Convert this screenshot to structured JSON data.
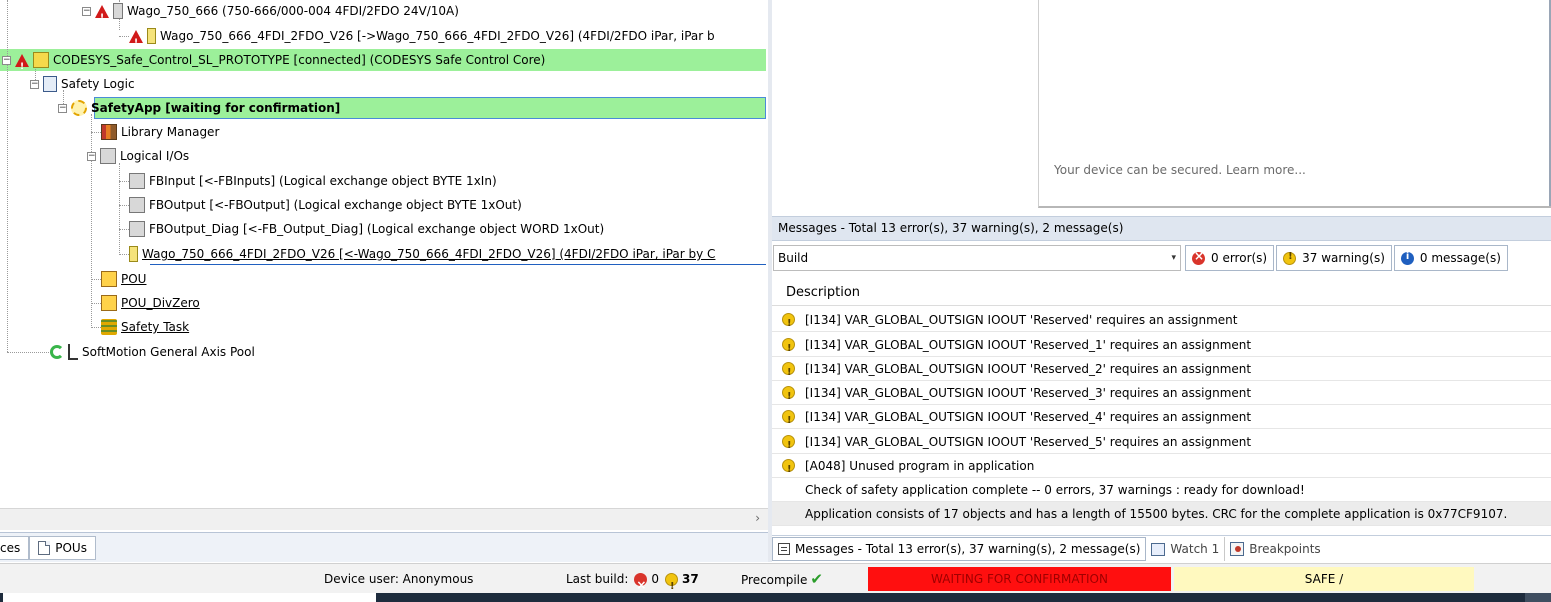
{
  "tree": {
    "rows": [
      {
        "text": "Wago_750_666 (750-666/000-004 4FDI/2FDO 24V/10A)"
      },
      {
        "text": "Wago_750_666_4FDI_2FDO_V26 [->Wago_750_666_4FDI_2FDO_V26]  (4FDI/2FDO iPar, iPar b"
      },
      {
        "text": "CODESYS_Safe_Control_SL_PROTOTYPE [connected] (CODESYS Safe Control Core)"
      },
      {
        "text": "Safety Logic"
      },
      {
        "text": "SafetyApp [waiting for confirmation]"
      },
      {
        "text": "Library Manager"
      },
      {
        "text": "Logical I/Os"
      },
      {
        "text": "FBInput [<-FBInputs]  (Logical exchange object BYTE 1xIn)"
      },
      {
        "text": "FBOutput [<-FBOutput]  (Logical exchange object BYTE 1xOut)"
      },
      {
        "text": "FBOutput_Diag [<-FB_Output_Diag]  (Logical exchange object WORD 1xOut)"
      },
      {
        "text": "Wago_750_666_4FDI_2FDO_V26 [<-Wago_750_666_4FDI_2FDO_V26]  (4FDI/2FDO iPar, iPar by C"
      },
      {
        "text": "POU"
      },
      {
        "text": "POU_DivZero"
      },
      {
        "text": "Safety Task"
      },
      {
        "text": "SoftMotion General Axis Pool"
      }
    ],
    "expander_collapse": "−"
  },
  "left_tabs": {
    "devices_label": "ces",
    "pous_label": "POUs"
  },
  "scroll_arrow": "›",
  "browser": {
    "secured_text": "Your device can be secured. Learn more..."
  },
  "messages": {
    "title": "Messages - Total 13 error(s), 37 warning(s), 2 message(s)",
    "source_select": "Build",
    "dropdown_glyph": "▾",
    "filters": {
      "errors": "0 error(s)",
      "warnings": "37 warning(s)",
      "messages": "0 message(s)"
    },
    "column_description": "Description",
    "rows": [
      {
        "text": "[I134] VAR_GLOBAL_OUTSIGN IOOUT 'Reserved' requires an assignment"
      },
      {
        "text": "[I134] VAR_GLOBAL_OUTSIGN IOOUT 'Reserved_1' requires an assignment"
      },
      {
        "text": "[I134] VAR_GLOBAL_OUTSIGN IOOUT 'Reserved_2' requires an assignment"
      },
      {
        "text": "[I134] VAR_GLOBAL_OUTSIGN IOOUT 'Reserved_3' requires an assignment"
      },
      {
        "text": "[I134] VAR_GLOBAL_OUTSIGN IOOUT 'Reserved_4' requires an assignment"
      },
      {
        "text": "[I134] VAR_GLOBAL_OUTSIGN IOOUT 'Reserved_5' requires an assignment"
      },
      {
        "text": "[A048] Unused program in application"
      },
      {
        "text": "Check of safety application complete -- 0 errors, 37 warnings : ready for download!"
      },
      {
        "text": "Application consists of 17 objects and has a length of 15500 bytes. CRC for the complete application is 0x77CF9107."
      }
    ]
  },
  "bottom_tabs": {
    "messages": "Messages - Total 13 error(s), 37 warning(s), 2 message(s)",
    "watch": "Watch 1",
    "breakpoints": "Breakpoints"
  },
  "status": {
    "device_user": "Device user: Anonymous",
    "last_build_label": "Last build:",
    "last_build_errors": "0",
    "last_build_warnings": "37",
    "precompile": "Precompile",
    "precompile_check": "✔",
    "state": "WAITING FOR CONFIRMATION",
    "safe": "SAFE /"
  },
  "colors": {
    "highlight_green": "#9cf09a",
    "status_red": "#ff0f0f",
    "status_yellow": "#fff9bf",
    "accent_blue": "#1f5fbf"
  }
}
